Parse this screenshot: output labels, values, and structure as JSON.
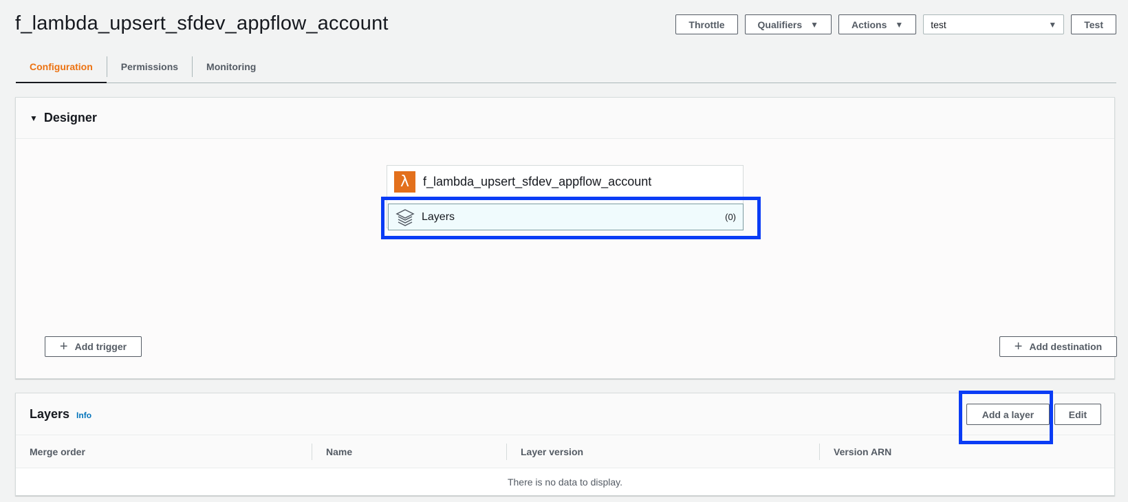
{
  "page": {
    "title": "f_lambda_upsert_sfdev_appflow_account"
  },
  "top_actions": {
    "throttle": "Throttle",
    "qualifiers": "Qualifiers",
    "actions": "Actions",
    "test_event_value": "test",
    "test": "Test"
  },
  "tabs": [
    {
      "label": "Configuration",
      "active": true
    },
    {
      "label": "Permissions",
      "active": false
    },
    {
      "label": "Monitoring",
      "active": false
    }
  ],
  "designer": {
    "header": "Designer",
    "function_name": "f_lambda_upsert_sfdev_appflow_account",
    "layers_label": "Layers",
    "layers_count": "(0)",
    "add_trigger": "Add trigger",
    "add_destination": "Add destination"
  },
  "layers_panel": {
    "title": "Layers",
    "info": "Info",
    "add_layer": "Add a layer",
    "edit": "Edit",
    "columns": [
      "Merge order",
      "Name",
      "Layer version",
      "Version ARN"
    ],
    "empty_message": "There is no data to display."
  },
  "colors": {
    "accent": "#ec7211",
    "highlight": "#0a3cf5",
    "lambda": "#e3701c",
    "link": "#0073bb"
  }
}
